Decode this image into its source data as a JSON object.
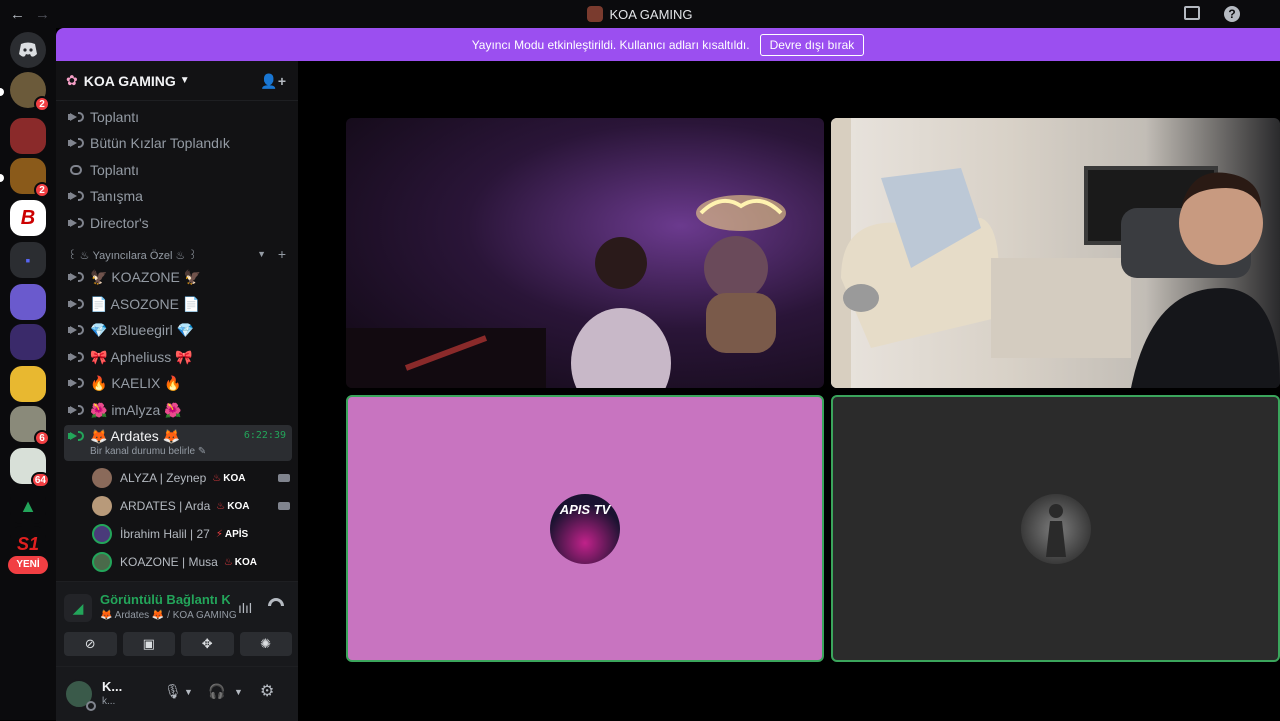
{
  "titlebar": {
    "title": "KOA GAMING",
    "back": "←",
    "forward": "→"
  },
  "banner": {
    "text": "Yayıncı Modu etkinleştirildi. Kullanıcı adları kısaltıldı.",
    "button": "Devre dışı bırak"
  },
  "rail": {
    "badges": [
      "2",
      "2",
      "6",
      "64"
    ],
    "new_label": "YENİ",
    "b_label": "B",
    "s1_label": "S1"
  },
  "server": {
    "name": "KOA GAMING"
  },
  "channels": [
    "Toplantı",
    "Bütün Kızlar Toplandık",
    "Toplantı",
    "Tanışma",
    "Director's"
  ],
  "category": {
    "label": "꒰ ♨ Yayıncılara Özel ♨ ꒱"
  },
  "streamer_channels": [
    "🦅 KOAZONE 🦅",
    "📄 ASOZONE 📄",
    "💎 xBlueegirl 💎",
    "🎀 Apheliuss 🎀",
    "🔥 KAELIX 🔥",
    "🌺 imAlyza 🌺"
  ],
  "active_channel": {
    "label": "🦊 Ardates 🦊",
    "timer": "6:22:39",
    "status": "Bir kanal durumu belirle ✎"
  },
  "members": [
    {
      "name": "ALYZA | Zeynep",
      "tag": "KOA",
      "color": "#8a6a5a"
    },
    {
      "name": "ARDATES | Arda",
      "tag": "KOA",
      "color": "#b89a7a"
    },
    {
      "name": "İbrahim Halil | 27",
      "tag": "APİS",
      "color": "#4a3a7a"
    },
    {
      "name": "KOAZONE | Musa",
      "tag": "KOA",
      "color": "#4a6a4a"
    }
  ],
  "voice": {
    "status": "Görüntülü Bağlantı Kuruldu",
    "where": "🦊 Ardates 🦊 / KOA GAMING"
  },
  "user": {
    "name": "K...",
    "sub": "k..."
  },
  "tiles": {
    "apis_label": "APIS TV"
  },
  "colors": {
    "accent": "#9b4ff0",
    "online": "#23a55a",
    "danger": "#f23f43",
    "pink_tile": "#c874c0"
  }
}
